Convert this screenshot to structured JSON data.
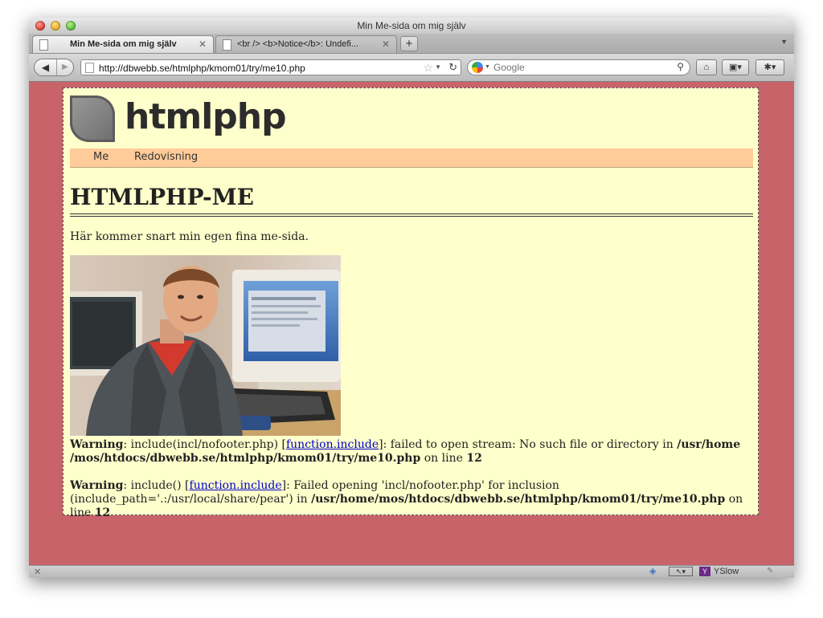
{
  "window": {
    "title": "Min Me-sida om mig själv"
  },
  "tabs": [
    {
      "label": "Min Me-sida om mig själv",
      "active": true
    },
    {
      "label": "<br /> <b>Notice</b>: Undefi...",
      "active": false
    }
  ],
  "toolbar": {
    "new_tab": "+",
    "url": "http://dbwebb.se/htmlphp/kmom01/try/me10.php",
    "search_placeholder": "Google"
  },
  "site": {
    "logo_text": "htmlphp",
    "menu": [
      "Me",
      "Redovisning"
    ]
  },
  "main": {
    "heading": "HTMLPHP-ME",
    "intro": "Här kommer snart min egen fina me-sida."
  },
  "errors": [
    {
      "label": "Warning",
      "pre": ": include(incl/nofooter.php) [",
      "link": "function.include",
      "post": "]: failed to open stream: No such file or directory in ",
      "path": "/usr/home /mos/htdocs/dbwebb.se/htmlphp/kmom01/try/me10.php",
      "line_label": " on line ",
      "line": "12"
    },
    {
      "label": "Warning",
      "pre": ": include() [",
      "link": "function.include",
      "post": "]: Failed opening 'incl/nofooter.php' for inclusion (include_path='.:/usr/local/share/pear') in ",
      "path": "/usr/home/mos/htdocs/dbwebb.se/htmlphp/kmom01/try/me10.php",
      "line_label": " on line ",
      "line": "12"
    }
  ],
  "status": {
    "yslow": "YSlow"
  },
  "colors": {
    "page_bg": "#c8636a",
    "content_bg": "#ffffcc",
    "menu_bg": "#ffcc99",
    "link": "#0000cc"
  }
}
